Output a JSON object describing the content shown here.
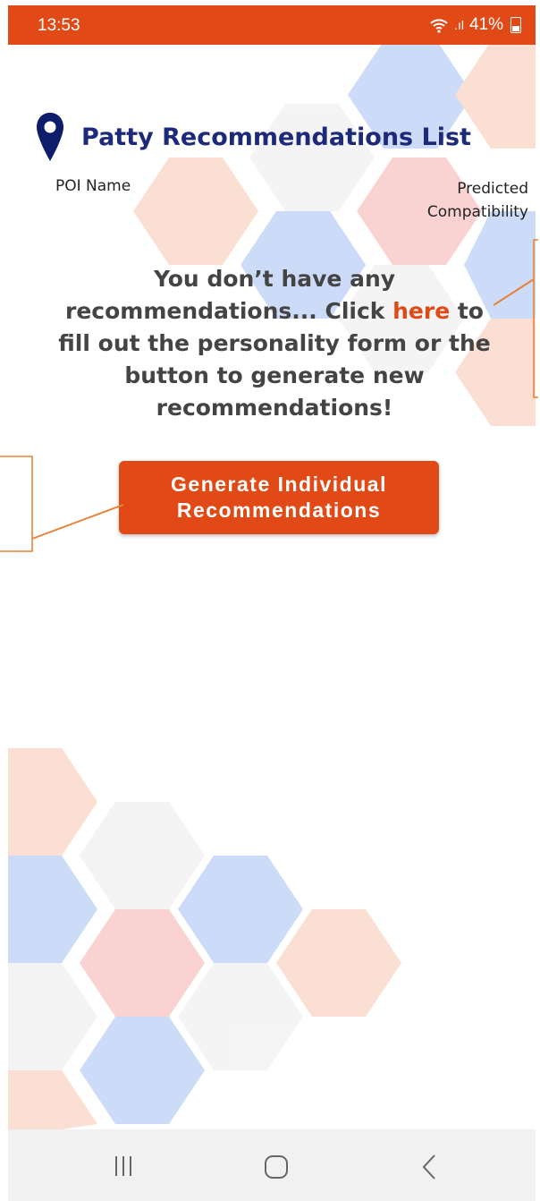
{
  "status_bar": {
    "time": "13:53",
    "signal_text": ".ıl",
    "battery": "41%"
  },
  "header": {
    "title": "Patty Recommendations List",
    "icon": "location-pin-icon"
  },
  "columns": {
    "left": "POI Name",
    "right": "Predicted Compatibility"
  },
  "message": {
    "part1": "You don’t have any recommendations... Click ",
    "link": "here",
    "part2": " to fill out the personality form or the button to generate new recommendations!"
  },
  "button": {
    "label_line1": "Generate Individual",
    "label_line2": "Recommendations"
  },
  "nav": {
    "recent_icon": "recent-apps-icon",
    "home_icon": "home-icon",
    "back_icon": "back-icon"
  },
  "colors": {
    "accent": "#e14a16",
    "title": "#1d2a7a",
    "annotation": "#e8833a"
  }
}
